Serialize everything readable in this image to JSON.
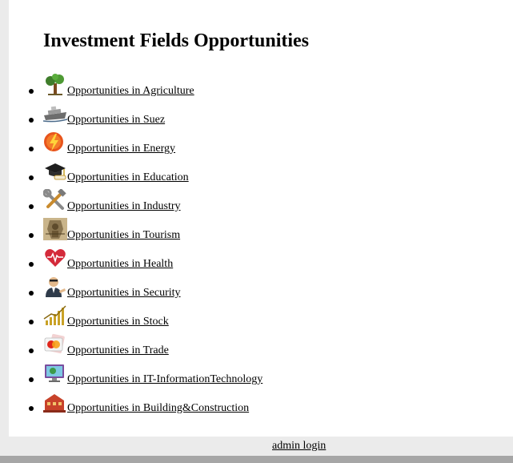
{
  "page": {
    "title": "Investment Fields Opportunities"
  },
  "opportunities": [
    {
      "label": "Opportunities in Agriculture",
      "icon": "tree-icon"
    },
    {
      "label": "Opportunities in Suez",
      "icon": "ship-icon"
    },
    {
      "label": "Opportunities in Energy",
      "icon": "lightning-icon"
    },
    {
      "label": "Opportunities in Education",
      "icon": "graduation-cap-icon"
    },
    {
      "label": "Opportunities in Industry",
      "icon": "tools-icon"
    },
    {
      "label": "Opportunities in Tourism",
      "icon": "pharaoh-icon"
    },
    {
      "label": "Opportunities in Health",
      "icon": "heart-icon"
    },
    {
      "label": "Opportunities in Security",
      "icon": "guard-icon"
    },
    {
      "label": "Opportunities in Stock",
      "icon": "growth-chart-icon"
    },
    {
      "label": "Opportunities in Trade",
      "icon": "credit-card-icon"
    },
    {
      "label": "Opportunities in IT-InformationTechnology",
      "icon": "computer-icon"
    },
    {
      "label": "Opportunities in Building&Construction",
      "icon": "building-icon"
    }
  ],
  "footer": {
    "admin_login": "admin login"
  },
  "colors": {
    "side_strip": "#ebebeb",
    "bottom_bar": "#a6a6a6",
    "link": "#000000"
  }
}
